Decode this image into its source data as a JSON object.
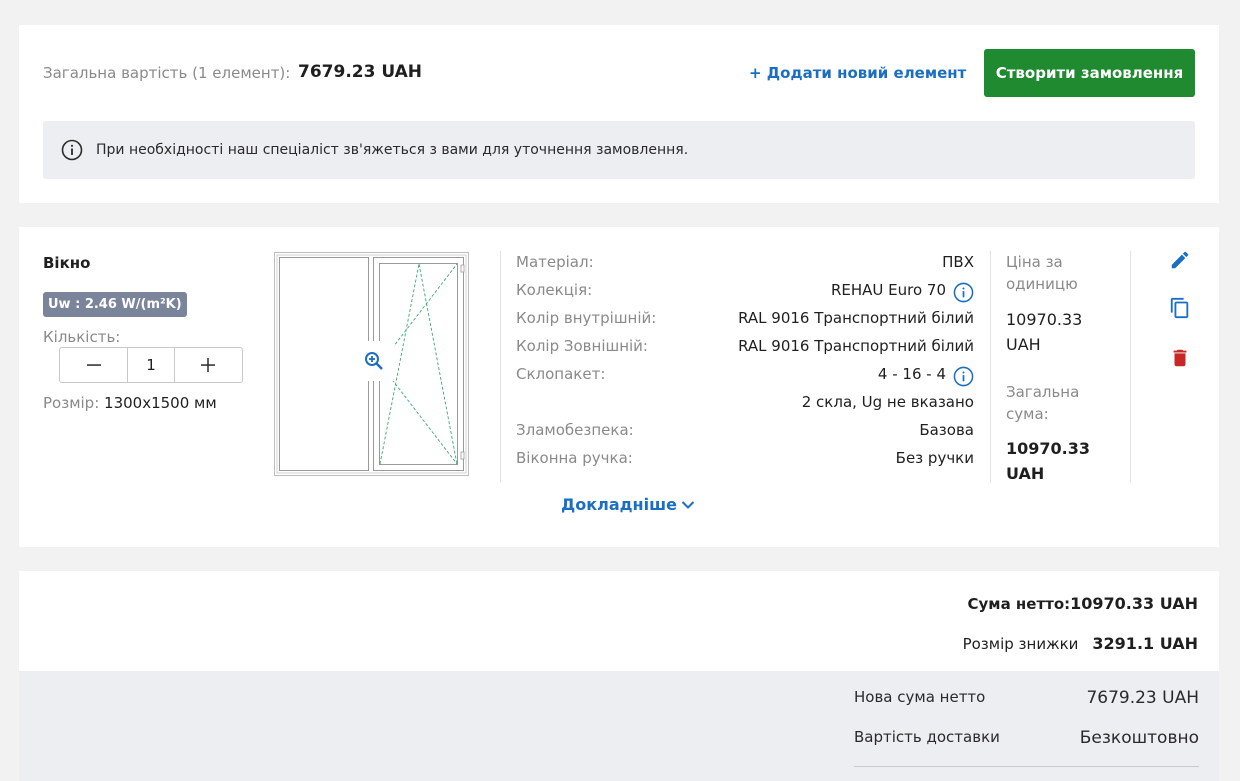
{
  "header": {
    "total_label": "Загальна вартість (1 елемент):",
    "total_value": "7679.23 UAH",
    "add_label": "+ Додати новий елемент",
    "create_label": "Створити замовлення",
    "info_text": "При необхідності наш спеціаліст зв'яжеться з вами для уточнення замовлення."
  },
  "product": {
    "name": "Вікно",
    "uw_badge": "Uw : 2.46 W/(m²K)",
    "qty_label": "Кількість:",
    "qty_value": "1",
    "size_label": "Розмір:",
    "size_value": "1300x1500 мм",
    "specs": [
      {
        "k": "Матеріал:",
        "v": "ПВХ"
      },
      {
        "k": "Колекція:",
        "v": "REHAU Euro 70",
        "info": true
      },
      {
        "k": "Колір внутрішній:",
        "v": "RAL 9016 Транспортний білий"
      },
      {
        "k": "Колір Зовнішній:",
        "v": "RAL 9016 Транспортний білий"
      },
      {
        "k": "Склопакет:",
        "v": "4 - 16 - 4",
        "info": true
      },
      {
        "k": "",
        "v": "2 скла, Ug не вказано"
      },
      {
        "k": "Зламобезпека:",
        "v": "Базова"
      },
      {
        "k": "Віконна ручка:",
        "v": "Без ручки"
      }
    ],
    "unit_price_label": "Ціна за одиницю",
    "unit_price_value": "10970.33 UAH",
    "total_sum_label": "Загальна сума:",
    "total_sum_value": "10970.33 UAH",
    "details_label": "Докладніше",
    "icons": [
      "edit-icon",
      "copy-icon",
      "delete-icon"
    ]
  },
  "summary": {
    "net_label": "Сума нетто:",
    "net_value": "10970.33 UAH",
    "discount_label": "Розмір знижки",
    "discount_value": "3291.1 UAH",
    "new_net_label": "Нова сума нетто",
    "new_net_value": "7679.23 UAH",
    "delivery_label": "Вартість доставки",
    "delivery_value": "Безкоштовно"
  },
  "colors": {
    "accent_blue": "#1b6fc2",
    "create_green": "#1f8a2f",
    "delete_red": "#c62828",
    "badge_grey": "#7a849b"
  }
}
